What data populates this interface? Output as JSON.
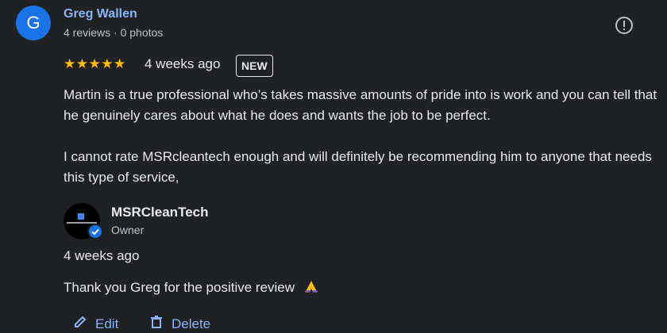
{
  "reviewer": {
    "initial": "G",
    "name": "Greg Wallen",
    "meta": "4 reviews · 0 photos",
    "avatar_color": "#1a73e8"
  },
  "review": {
    "stars": "★★★★★",
    "rating": 5,
    "time": "4 weeks ago",
    "badge": "NEW",
    "paragraphs": [
      "Martin is a true professional who’s takes massive amounts of pride into is work and you can tell that he genuinely cares about what he does and wants the job to be perfect.",
      "I cannot rate MSRcleantech enough and will definitely be recommending him to anyone that needs this type of service,"
    ]
  },
  "reply": {
    "owner_name": "MSRCleanTech",
    "owner_role": "Owner",
    "time": "4 weeks ago",
    "text": "Thank you Greg for the positive review"
  },
  "actions": {
    "edit": "Edit",
    "delete": "Delete"
  },
  "icons": {
    "flag": "report-flag-icon",
    "verified": "verified-badge-icon",
    "edit": "pencil-icon",
    "delete": "trash-icon",
    "emoji": "folded-hands-emoji"
  },
  "colors": {
    "background": "#202124",
    "link": "#8ab4f8",
    "star": "#fbbc04",
    "verified": "#1a73e8"
  }
}
